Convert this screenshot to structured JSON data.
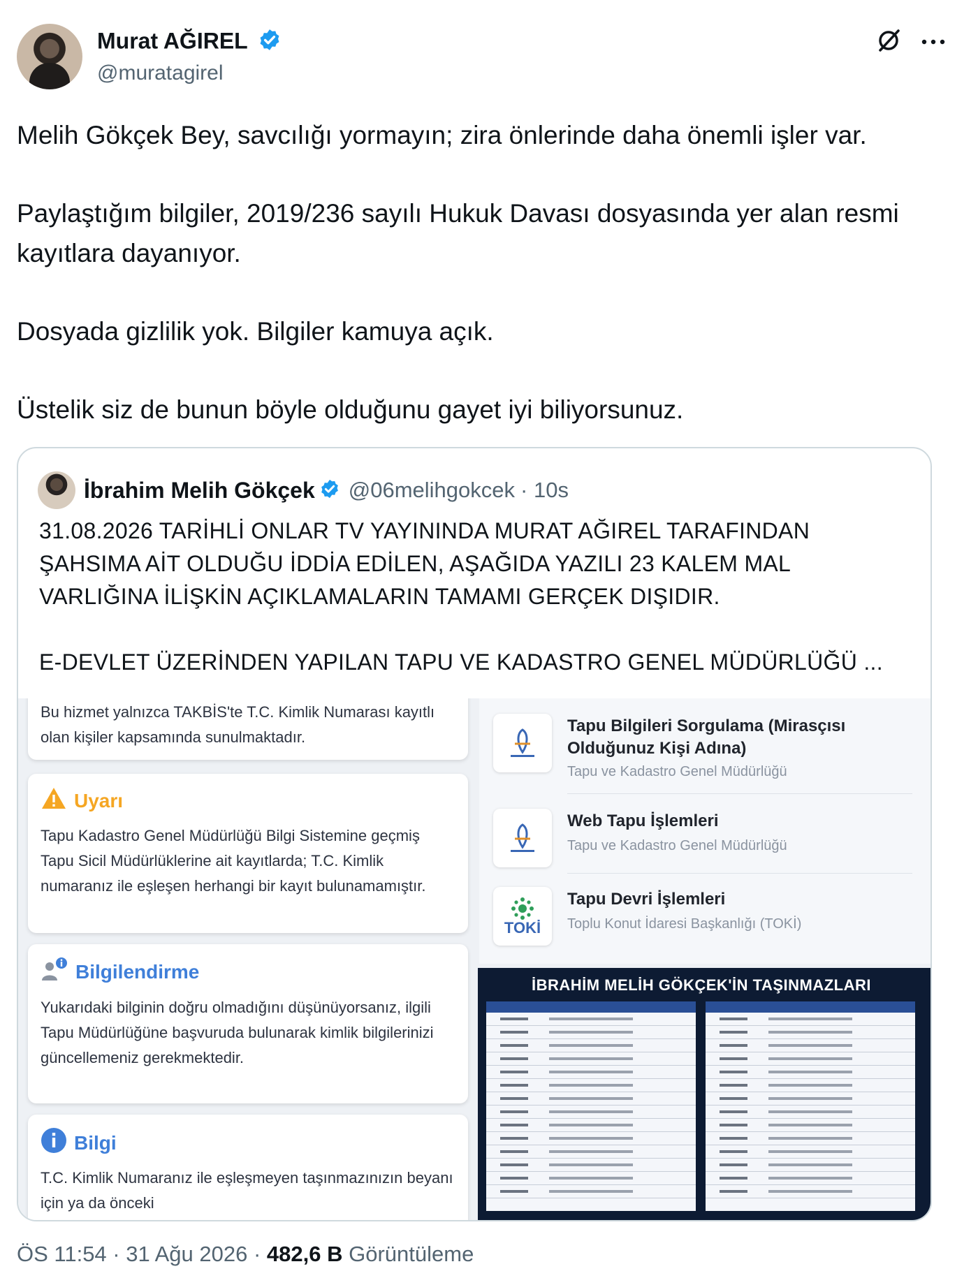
{
  "author": {
    "name": "Murat AĞIREL",
    "handle": "@muratagirel"
  },
  "tweet": {
    "paragraphs": [
      "Melih Gökçek Bey, savcılığı yormayın; zira önlerinde daha önemli işler var.",
      "Paylaştığım bilgiler, 2019/236 sayılı Hukuk Davası dosyasında yer alan resmi kayıtlara dayanıyor.",
      "Dosyada gizlilik yok. Bilgiler kamuya açık.",
      "Üstelik siz de bunun böyle olduğunu gayet iyi biliyorsunuz."
    ]
  },
  "quote": {
    "name": "İbrahim Melih Gökçek",
    "handle": "@06melihgokcek",
    "time": "· 10s",
    "paragraphs": [
      "31.08.2026 TARİHLİ ONLAR TV YAYININDA MURAT AĞIREL TARAFINDAN ŞAHSIMA AİT OLDUĞU İDDİA EDİLEN, AŞAĞIDA YAZILI 23 KALEM MAL VARLIĞINA İLİŞKİN AÇIKLAMALARIN TAMAMI GERÇEK DIŞIDIR.",
      "E-DEVLET ÜZERİNDEN YAPILAN TAPU VE KADASTRO GENEL MÜDÜRLÜĞÜ ..."
    ]
  },
  "media": {
    "top_card_text": "Bu hizmet yalnızca TAKBİS'te T.C. Kimlik Numarası kayıtlı olan kişiler kapsamında sunulmaktadır.",
    "warning": {
      "title": "Uyarı",
      "body": "Tapu Kadastro Genel Müdürlüğü Bilgi Sistemine geçmiş Tapu Sicil Müdürlüklerine ait kayıtlarda; T.C. Kimlik numaranız ile eşleşen herhangi bir kayıt bulunamamıştır."
    },
    "info_notice": {
      "title": "Bilgilendirme",
      "body": "Yukarıdaki bilginin doğru olmadığını düşünüyorsanız, ilgili Tapu Müdürlüğüne başvuruda bulunarak kimlik bilgilerinizi güncellemeniz gerekmektedir."
    },
    "info": {
      "title": "Bilgi",
      "body": "T.C. Kimlik Numaranız ile eşleşmeyen taşınmazınızın beyanı için ya da önceki"
    },
    "services": [
      {
        "title": "Tapu Bilgileri Sorgulama (Mirasçısı Olduğunuz Kişi Adına)",
        "subtitle": "Tapu ve Kadastro Genel Müdürlüğü"
      },
      {
        "title": "Web Tapu İşlemleri",
        "subtitle": "Tapu ve Kadastro Genel Müdürlüğü"
      },
      {
        "title": "Tapu Devri İşlemleri",
        "subtitle": "Toplu Konut İdaresi Başkanlığı (TOKİ)",
        "icon_label": "TOKİ"
      }
    ],
    "table_title": "İBRAHİM MELİH GÖKÇEK'İN TAŞINMAZLARI"
  },
  "footer": {
    "time": "ÖS 11:54 · 31 Ağu 2026 ·",
    "views_count": "482,6 B",
    "views_label": "Görüntüleme"
  },
  "icons": {
    "verified": "verified-badge-icon",
    "grok": "grok-icon",
    "more": "more-options-icon"
  },
  "colors": {
    "verified": "#1d9bf0",
    "warning": "#f5a623",
    "info": "#3f7fd9",
    "text": "#0f1419",
    "muted": "#536471"
  }
}
